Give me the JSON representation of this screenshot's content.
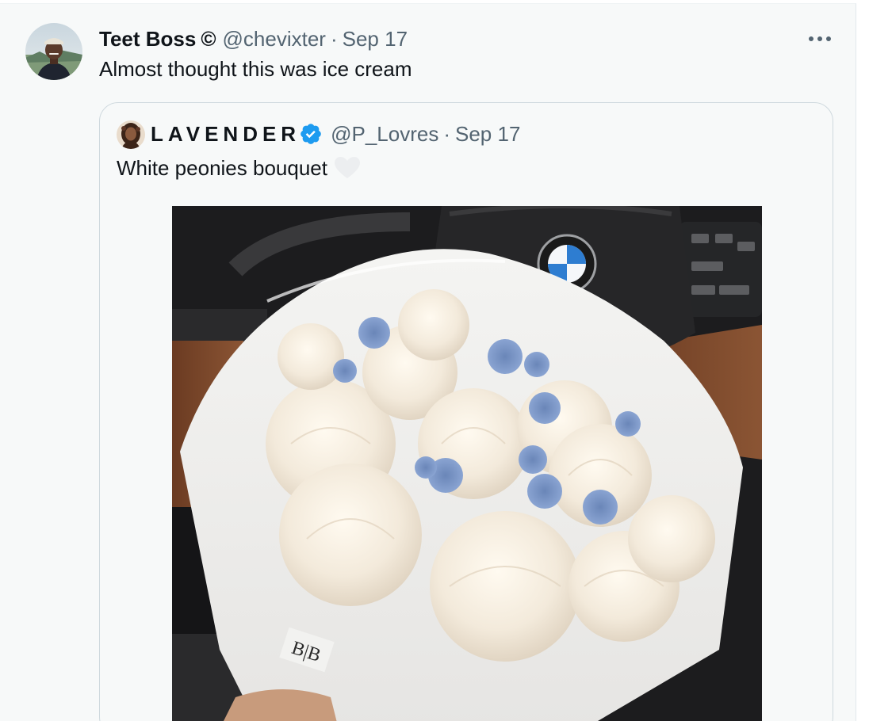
{
  "tweet": {
    "author": {
      "display_name": "Teet Boss",
      "badge": "©",
      "handle": "@chevixter",
      "separator": "·",
      "date": "Sep 17"
    },
    "text": "Almost thought this was ice cream",
    "more_icon": "more-horizontal-icon"
  },
  "quoted_tweet": {
    "author": {
      "display_name": "LAVENDER",
      "verified": true,
      "handle": "@P_Lovres",
      "separator": "·",
      "date": "Sep 17"
    },
    "text": "White peonies bouquet",
    "emoji": "white-heart-icon",
    "media": {
      "wrapper_label": "B|B"
    }
  },
  "colors": {
    "background": "#f7f9f9",
    "text_primary": "#0f1419",
    "text_secondary": "#536471",
    "border": "#cfd9de",
    "verified_blue": "#1d9bf0"
  }
}
